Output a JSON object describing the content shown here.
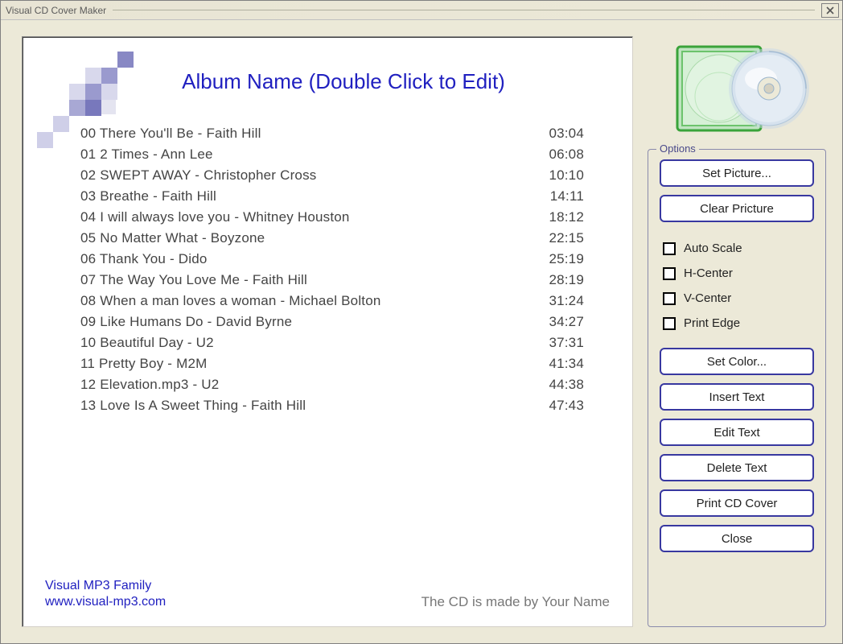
{
  "window": {
    "title": "Visual CD Cover Maker"
  },
  "cover": {
    "album_title": "Album Name (Double Click to Edit)",
    "footer_brand": "Visual MP3 Family",
    "footer_url": "www.visual-mp3.com",
    "footer_made_by": "The CD is made by Your Name",
    "tracks": [
      {
        "n": "00",
        "title": "There You'll Be - Faith Hill",
        "time": "03:04"
      },
      {
        "n": "01",
        "title": "2 Times - Ann Lee",
        "time": "06:08"
      },
      {
        "n": "02",
        "title": "SWEPT AWAY - Christopher Cross",
        "time": "10:10"
      },
      {
        "n": "03",
        "title": "Breathe - Faith Hill",
        "time": "14:11"
      },
      {
        "n": "04",
        "title": "I will always love you - Whitney Houston",
        "time": "18:12"
      },
      {
        "n": "05",
        "title": "No Matter What - Boyzone",
        "time": "22:15"
      },
      {
        "n": "06",
        "title": "Thank You - Dido",
        "time": "25:19"
      },
      {
        "n": "07",
        "title": "The Way You Love Me - Faith Hill",
        "time": "28:19"
      },
      {
        "n": "08",
        "title": "When a man loves a woman - Michael Bolton",
        "time": "31:24"
      },
      {
        "n": "09",
        "title": "Like Humans Do - David Byrne",
        "time": "34:27"
      },
      {
        "n": "10",
        "title": "Beautiful Day - U2",
        "time": "37:31"
      },
      {
        "n": "11",
        "title": "Pretty Boy - M2M",
        "time": "41:34"
      },
      {
        "n": "12",
        "title": "Elevation.mp3 - U2",
        "time": "44:38"
      },
      {
        "n": "13",
        "title": "Love Is A Sweet Thing - Faith Hill",
        "time": "47:43"
      }
    ]
  },
  "options": {
    "legend": "Options",
    "buttons": {
      "set_picture": "Set Picture...",
      "clear_picture": "Clear Pricture",
      "set_color": "Set Color...",
      "insert_text": "Insert Text",
      "edit_text": "Edit Text",
      "delete_text": "Delete Text",
      "print_cover": "Print CD Cover",
      "close": "Close"
    },
    "checkboxes": {
      "auto_scale": "Auto Scale",
      "h_center": "H-Center",
      "v_center": "V-Center",
      "print_edge": "Print Edge"
    }
  }
}
